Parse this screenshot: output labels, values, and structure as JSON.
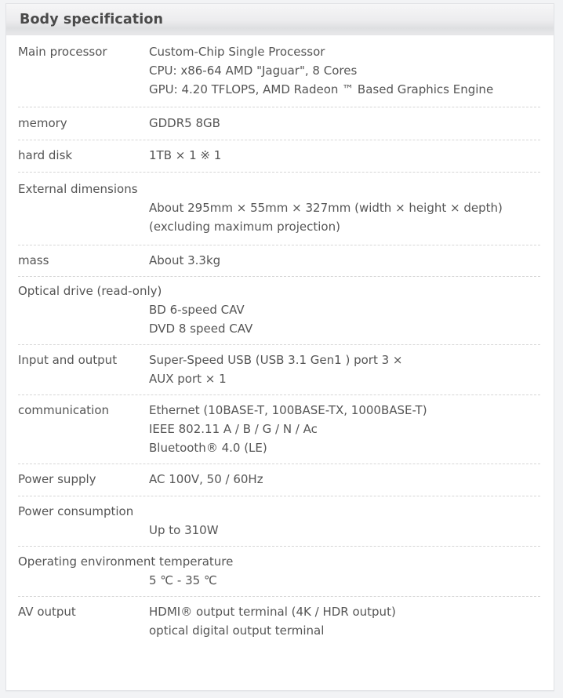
{
  "header": {
    "title": "Body specification"
  },
  "specs": [
    {
      "label": "Main processor",
      "layout": "inline",
      "values": [
        "Custom-Chip Single Processor",
        "CPU: x86-64 AMD \"Jaguar\", 8 Cores",
        "GPU: 4.20 TFLOPS, AMD Radeon ™ Based Graphics Engine"
      ]
    },
    {
      "label": "memory",
      "layout": "inline",
      "values": [
        "GDDR5 8GB"
      ]
    },
    {
      "label": "hard disk",
      "layout": "inline",
      "values": [
        "1TB × 1 ※ 1"
      ]
    },
    {
      "label": "External dimensions",
      "layout": "wrap",
      "values": [
        "About 295mm × 55mm × 327mm (width × height × depth)",
        "(excluding maximum projection)"
      ]
    },
    {
      "label": "mass",
      "layout": "inline",
      "values": [
        "About 3.3kg"
      ]
    },
    {
      "label": "Optical drive (read-only)",
      "layout": "wrap",
      "values": [
        "BD 6-speed CAV",
        "DVD 8 speed CAV"
      ]
    },
    {
      "label": "Input and output",
      "layout": "inline",
      "values": [
        "Super-Speed USB (USB 3.1 Gen1 ) port 3 ×",
        "AUX port × 1"
      ]
    },
    {
      "label": "communication",
      "layout": "inline",
      "values": [
        "Ethernet (10BASE-T, 100BASE-TX, 1000BASE-T)",
        "IEEE 802.11 A / B / G / N / Ac",
        "Bluetooth® 4.0 (LE)"
      ]
    },
    {
      "label": "Power supply",
      "layout": "inline",
      "values": [
        "AC 100V, 50 / 60Hz"
      ]
    },
    {
      "label": "Power consumption",
      "layout": "wrap",
      "values": [
        "Up to 310W"
      ]
    },
    {
      "label": "Operating environment temperature",
      "layout": "wrap",
      "values": [
        "5 ℃ - 35 ℃"
      ]
    },
    {
      "label": "AV output",
      "layout": "inline",
      "values": [
        "HDMI® output terminal (4K / HDR output)",
        "optical digital output terminal"
      ]
    }
  ]
}
